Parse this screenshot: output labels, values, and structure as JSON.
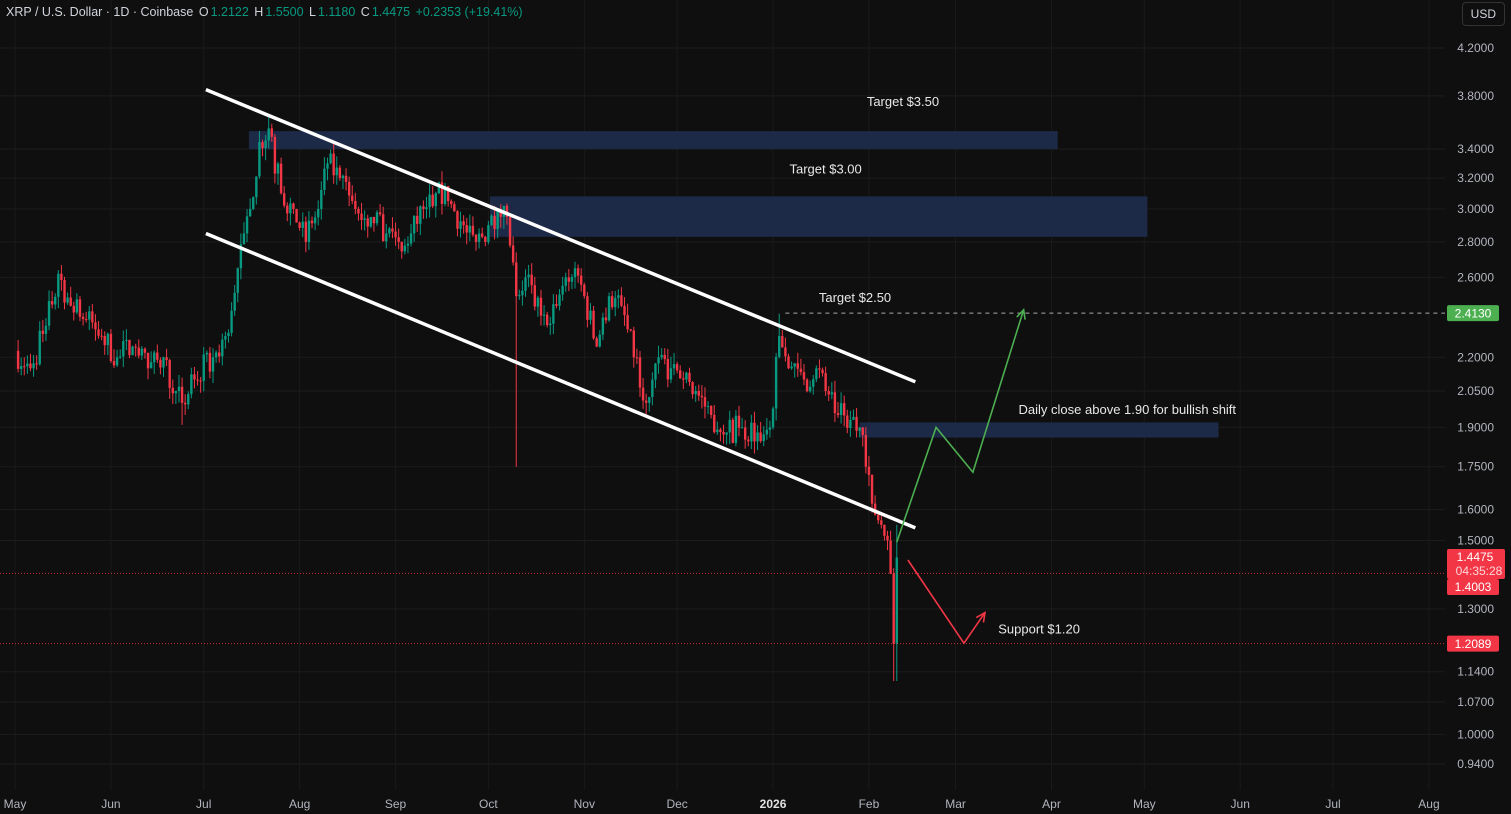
{
  "header": {
    "symbol": "XRP / U.S. Dollar · 1D · Coinbase",
    "o_label": "O",
    "open": "1.2122",
    "h_label": "H",
    "high": "1.5500",
    "l_label": "L",
    "low": "1.1180",
    "c_label": "C",
    "close": "1.4475",
    "change": "+0.2353 (+19.41%)",
    "currency": "USD"
  },
  "colors": {
    "up": "#089981",
    "down": "#f23645",
    "zone": "#1c2a47",
    "bg": "#0f0f0f",
    "green_path": "#4caf50",
    "red_path": "#f23645"
  },
  "chart_data": {
    "type": "candlestick",
    "title": "XRP / U.S. Dollar · 1D · Coinbase",
    "x_unit": "days since May 1 2025",
    "y_scale": "log",
    "ylim": [
      0.9,
      4.35
    ],
    "xlim": [
      0,
      460
    ],
    "x_ticks": [
      {
        "day": 0,
        "label": "May"
      },
      {
        "day": 31,
        "label": "Jun"
      },
      {
        "day": 61,
        "label": "Jul"
      },
      {
        "day": 92,
        "label": "Aug"
      },
      {
        "day": 123,
        "label": "Sep"
      },
      {
        "day": 153,
        "label": "Oct"
      },
      {
        "day": 184,
        "label": "Nov"
      },
      {
        "day": 214,
        "label": "Dec"
      },
      {
        "day": 245,
        "label": "2026"
      },
      {
        "day": 276,
        "label": "Feb"
      },
      {
        "day": 304,
        "label": "Mar"
      },
      {
        "day": 335,
        "label": "Apr"
      },
      {
        "day": 365,
        "label": "May"
      },
      {
        "day": 396,
        "label": "Jun"
      },
      {
        "day": 426,
        "label": "Jul"
      },
      {
        "day": 457,
        "label": "Aug"
      }
    ],
    "y_ticks": [
      "4.2000",
      "3.8000",
      "3.4000",
      "3.2000",
      "3.0000",
      "2.8000",
      "2.6000",
      "2.2000",
      "2.0500",
      "1.9000",
      "1.7500",
      "1.6000",
      "1.5000",
      "1.3000",
      "1.1400",
      "1.0700",
      "1.0000",
      "0.9400"
    ],
    "close_path": [
      [
        0,
        2.23
      ],
      [
        5,
        2.15
      ],
      [
        10,
        2.35
      ],
      [
        14,
        2.62
      ],
      [
        18,
        2.45
      ],
      [
        23,
        2.38
      ],
      [
        28,
        2.3
      ],
      [
        33,
        2.2
      ],
      [
        38,
        2.25
      ],
      [
        43,
        2.15
      ],
      [
        48,
        2.2
      ],
      [
        52,
        2.05
      ],
      [
        54,
        2.0,
        1.91
      ],
      [
        58,
        2.1
      ],
      [
        64,
        2.2
      ],
      [
        68,
        2.3
      ],
      [
        72,
        2.65
      ],
      [
        76,
        3.0
      ],
      [
        79,
        3.45
      ],
      [
        82,
        3.55,
        null,
        3.65
      ],
      [
        86,
        3.1
      ],
      [
        90,
        3.0
      ],
      [
        94,
        2.8
      ],
      [
        98,
        3.0
      ],
      [
        101,
        3.3
      ],
      [
        105,
        3.2
      ],
      [
        110,
        3.0
      ],
      [
        115,
        2.95
      ],
      [
        120,
        2.85
      ],
      [
        124,
        2.8
      ],
      [
        128,
        2.85
      ],
      [
        132,
        3.0
      ],
      [
        136,
        3.1
      ],
      [
        140,
        3.05
      ],
      [
        145,
        2.9
      ],
      [
        149,
        2.8
      ],
      [
        153,
        2.9
      ],
      [
        156,
        3.0
      ],
      [
        159,
        2.95
      ],
      [
        162,
        2.5,
        1.75
      ],
      [
        165,
        2.6
      ],
      [
        170,
        2.4
      ],
      [
        175,
        2.45
      ],
      [
        178,
        2.6
      ],
      [
        181,
        2.65
      ],
      [
        184,
        2.5
      ],
      [
        188,
        2.25
      ],
      [
        192,
        2.5
      ],
      [
        196,
        2.45
      ],
      [
        200,
        2.2
      ],
      [
        204,
        2.0
      ],
      [
        208,
        2.2
      ],
      [
        212,
        2.15
      ],
      [
        216,
        2.1
      ],
      [
        220,
        2.05
      ],
      [
        225,
        1.95
      ],
      [
        230,
        1.88
      ],
      [
        235,
        1.9
      ],
      [
        240,
        1.88
      ],
      [
        244,
        1.9
      ],
      [
        247,
        2.3,
        null,
        2.41
      ],
      [
        250,
        2.15
      ],
      [
        255,
        2.1
      ],
      [
        259,
        2.15
      ],
      [
        262,
        2.05
      ],
      [
        266,
        1.95
      ],
      [
        270,
        1.93
      ],
      [
        273,
        1.9
      ],
      [
        275,
        1.75
      ],
      [
        277,
        1.62
      ],
      [
        280,
        1.55
      ],
      [
        282,
        1.5
      ],
      [
        283,
        1.4
      ],
      [
        284,
        1.2089,
        1.118
      ],
      [
        285,
        1.4475,
        1.118,
        1.55
      ]
    ],
    "channel": {
      "upper": [
        [
          61.7,
          3.85
        ],
        [
          291,
          2.09
        ]
      ],
      "lower": [
        [
          61.7,
          2.85
        ],
        [
          291,
          1.54
        ]
      ]
    },
    "zones": [
      {
        "label": "Target $3.50",
        "from": 75.6,
        "to": 337,
        "top": 3.53,
        "bottom": 3.4,
        "label_day": 287,
        "label_price": 3.72
      },
      {
        "label": "Target $3.00",
        "from": 153.5,
        "to": 366,
        "top": 3.08,
        "bottom": 2.83,
        "label_day": 262,
        "label_price": 3.23
      },
      {
        "label": "Daily close above 1.90 for bullish shift",
        "from": 273,
        "to": 389,
        "top": 1.92,
        "bottom": 1.86,
        "label_day": 359.5,
        "label_price": 1.955
      }
    ],
    "annotations": [
      {
        "label": "Target $2.50",
        "day": 271.5,
        "price": 2.47
      },
      {
        "label": "Support $1.20",
        "day": 331,
        "price": 1.235
      }
    ],
    "target_line": {
      "day": 249,
      "price": 2.413,
      "label": "2.4130"
    },
    "green_path": [
      [
        285,
        1.495
      ],
      [
        297.7,
        1.9
      ],
      [
        309.6,
        1.73
      ],
      [
        326,
        2.43
      ]
    ],
    "red_path": [
      [
        288.6,
        1.44
      ],
      [
        306.7,
        1.21
      ],
      [
        313.5,
        1.29
      ]
    ],
    "price_labels": [
      {
        "text": "1.4475",
        "sub": "04:35:28",
        "price": 1.4475
      },
      {
        "text": "1.4003",
        "price": 1.4003
      },
      {
        "text": "1.2089",
        "price": 1.2089
      }
    ]
  }
}
